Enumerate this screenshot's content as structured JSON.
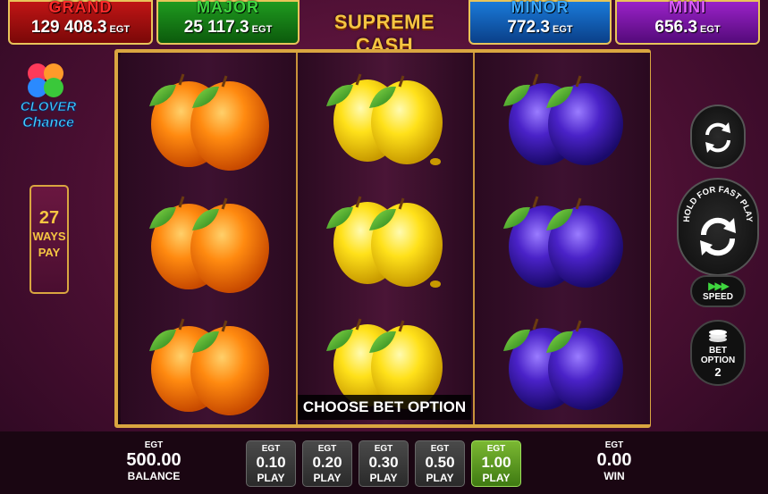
{
  "jackpots": [
    {
      "label": "GRAND",
      "value": "129 408.3",
      "currency": "EGT",
      "color": "#ff2a2a"
    },
    {
      "label": "MAJOR",
      "value": "25 117.3",
      "currency": "EGT",
      "color": "#3fd63f"
    },
    {
      "label": "MINOR",
      "value": "772.3",
      "currency": "EGT",
      "color": "#3aa8ff"
    },
    {
      "label": "MINI",
      "value": "656.3",
      "currency": "EGT",
      "color": "#e05cff"
    }
  ],
  "game_title": "SUPREME CASH",
  "logo": {
    "line1": "CLOVER",
    "line2": "Chance"
  },
  "ways": {
    "count": "27",
    "line1": "WAYS",
    "line2": "PAY"
  },
  "reels": [
    {
      "symbol": "orange",
      "rows": [
        "orange",
        "orange",
        "orange"
      ]
    },
    {
      "symbol": "lemon",
      "rows": [
        "lemon",
        "lemon",
        "lemon"
      ]
    },
    {
      "symbol": "plum",
      "rows": [
        "plum",
        "plum",
        "plum"
      ]
    }
  ],
  "choose_bet_label": "CHOOSE BET OPTION",
  "controls": {
    "autoplay_icon": "refresh-icon",
    "spin_label": "HOLD FOR FAST PLAY",
    "speed_label": "SPEED",
    "bet_option_label1": "BET",
    "bet_option_label2": "OPTION",
    "bet_option_value": "2"
  },
  "balance": {
    "currency": "EGT",
    "amount": "500.00",
    "label": "BALANCE"
  },
  "bets": [
    {
      "currency": "EGT",
      "amount": "0.10",
      "label": "PLAY",
      "active": false
    },
    {
      "currency": "EGT",
      "amount": "0.20",
      "label": "PLAY",
      "active": false
    },
    {
      "currency": "EGT",
      "amount": "0.30",
      "label": "PLAY",
      "active": false
    },
    {
      "currency": "EGT",
      "amount": "0.50",
      "label": "PLAY",
      "active": false
    },
    {
      "currency": "EGT",
      "amount": "1.00",
      "label": "PLAY",
      "active": true
    }
  ],
  "win": {
    "currency": "EGT",
    "amount": "0.00",
    "label": "WIN"
  }
}
